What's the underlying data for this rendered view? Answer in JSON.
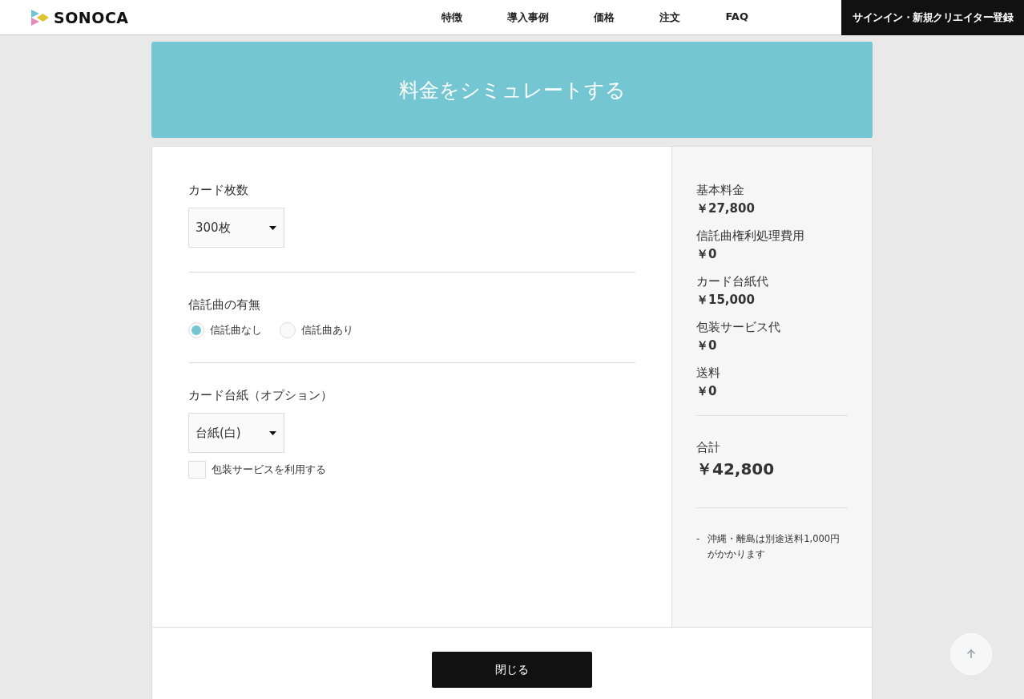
{
  "header": {
    "logo": "SONOCA",
    "nav": [
      {
        "label": "特徴"
      },
      {
        "label": "導入事例"
      },
      {
        "label": "価格"
      },
      {
        "label": "注文"
      },
      {
        "label": "FAQ"
      }
    ],
    "signin": "サインイン・新規クリエイター登録"
  },
  "modal": {
    "title": "料金をシミュレートする",
    "sections": [
      {
        "kind": "select",
        "label": "カード枚数",
        "value": "300枚"
      },
      {
        "kind": "radio",
        "label": "信託曲の有無",
        "options": [
          {
            "label": "信託曲なし",
            "selected": true
          },
          {
            "label": "信託曲あり",
            "selected": false
          }
        ]
      },
      {
        "kind": "select",
        "label": "カード台紙（オプション）",
        "value": "台紙(白)",
        "checkbox": {
          "label": "包装サービスを利用する",
          "checked": false
        }
      }
    ],
    "summary": {
      "items": [
        {
          "label": "基本料金",
          "amount": "￥27,800"
        },
        {
          "label": "信託曲権利処理費用",
          "amount": "￥0"
        },
        {
          "label": "カード台紙代",
          "amount": "￥15,000"
        },
        {
          "label": "包装サービス代",
          "amount": "￥0"
        },
        {
          "label": "送料",
          "amount": "￥0"
        }
      ],
      "total": {
        "label": "合計",
        "amount": "￥42,800"
      },
      "notes": [
        {
          "marker": "-",
          "text": "沖縄・離島は別途送料1,000円がかかります"
        }
      ]
    },
    "close": "閉じる"
  }
}
